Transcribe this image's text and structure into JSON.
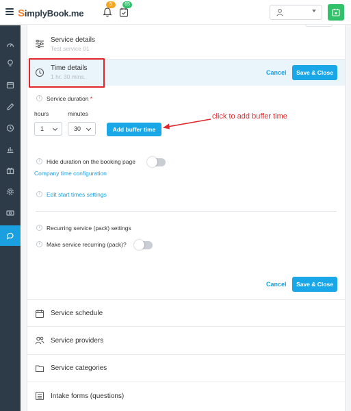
{
  "header": {
    "logo_s": "S",
    "logo_text": "implyBook",
    "logo_suffix": ".me",
    "notifications_count": "5",
    "tasks_count": "65",
    "icons": [
      "menu-icon",
      "bell-icon",
      "calendar-check-icon",
      "user-icon",
      "calendar-icon"
    ]
  },
  "sidebar": {
    "items": [
      "dashboard-icon",
      "lightbulb-icon",
      "calendar-icon",
      "pencil-icon",
      "clock-icon",
      "chart-icon",
      "gift-icon",
      "settings-icon",
      "cash-icon",
      "chat-icon"
    ],
    "active_index": 9
  },
  "service_details": {
    "title": "Service details",
    "subtitle": "Test service 01"
  },
  "time_details": {
    "title": "Time details",
    "subtitle": "1 hr. 30 mins.",
    "cancel_label": "Cancel",
    "save_label": "Save & Close"
  },
  "form": {
    "duration_label": "Service duration",
    "required_mark": "*",
    "hours_label": "hours",
    "minutes_label": "minutes",
    "hours_value": "1",
    "minutes_value": "30",
    "buffer_button": "Add buffer time",
    "annotation": "click to add buffer time",
    "hide_duration_label": "Hide duration on the booking page",
    "hide_duration_on": false,
    "company_time_link": "Company time configuration",
    "edit_start_times_link": "Edit start times settings",
    "recurring_settings_label": "Recurring service (pack) settings",
    "make_recurring_label": "Make service recurring (pack)?",
    "make_recurring_on": false,
    "cancel_label": "Cancel",
    "save_label": "Save & Close"
  },
  "sections": [
    {
      "title": "Service schedule",
      "icon": "calendar-icon"
    },
    {
      "title": "Service providers",
      "icon": "users-icon"
    },
    {
      "title": "Service categories",
      "icon": "folder-icon"
    },
    {
      "title": "Intake forms (questions)",
      "icon": "list-icon"
    }
  ],
  "colors": {
    "accent": "#1aa7e8",
    "sidebar": "#2d3b48",
    "highlight": "#e0262a",
    "success": "#31c16a",
    "warning": "#f5a623"
  }
}
